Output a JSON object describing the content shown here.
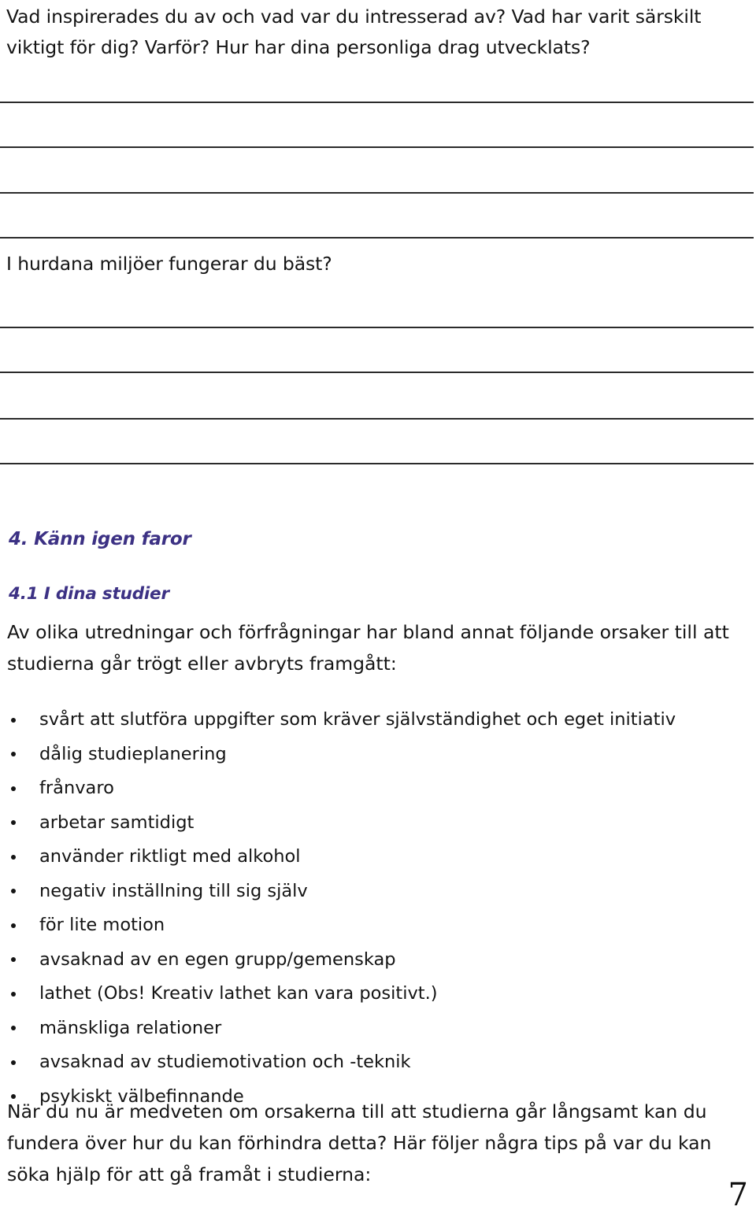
{
  "document": {
    "language": "sv",
    "page_number": "7",
    "heading_color": "#3c3184",
    "rule_color": "#2b2b2b"
  },
  "questions": [
    {
      "id": "q-inspiration",
      "text": "Vad inspirerades du av och vad var du intresserad av? Vad har varit särskilt viktigt för dig? Varför? Hur har dina personliga drag utvecklats?",
      "answer_lines": 4
    },
    {
      "id": "q-environment",
      "text": "I hurdana miljöer fungerar du bäst?",
      "answer_lines": 4
    }
  ],
  "section": {
    "number": "4.",
    "title": "4. Känn igen faror",
    "subsection_title": "4.1  I dina studier",
    "intro_paragraph": "Av olika utredningar och förfrågningar har bland annat följande orsaker till att studierna går trögt eller avbryts framgått:",
    "bullets": [
      "svårt att slutföra uppgifter som kräver självständighet och eget initiativ",
      "dålig studieplanering",
      "frånvaro",
      "arbetar samtidigt",
      "använder riktligt med alkohol",
      "negativ inställning till sig själv",
      "för lite motion",
      "avsaknad av en egen grupp/gemenskap",
      "lathet (Obs! Kreativ lathet kan vara positivt.)",
      "mänskliga relationer",
      "avsaknad av studiemotivation och -teknik",
      "psykiskt välbefinnande"
    ],
    "closing_paragraph": "När du nu är medveten om orsakerna till att studierna går långsamt kan du fundera över hur du kan förhindra detta? Här följer några tips på var du kan söka hjälp för att gå framåt i studierna:"
  },
  "rules": {
    "block1_y": [
      129,
      186,
      244,
      301
    ],
    "block2_y": [
      415,
      472,
      531,
      588
    ]
  }
}
